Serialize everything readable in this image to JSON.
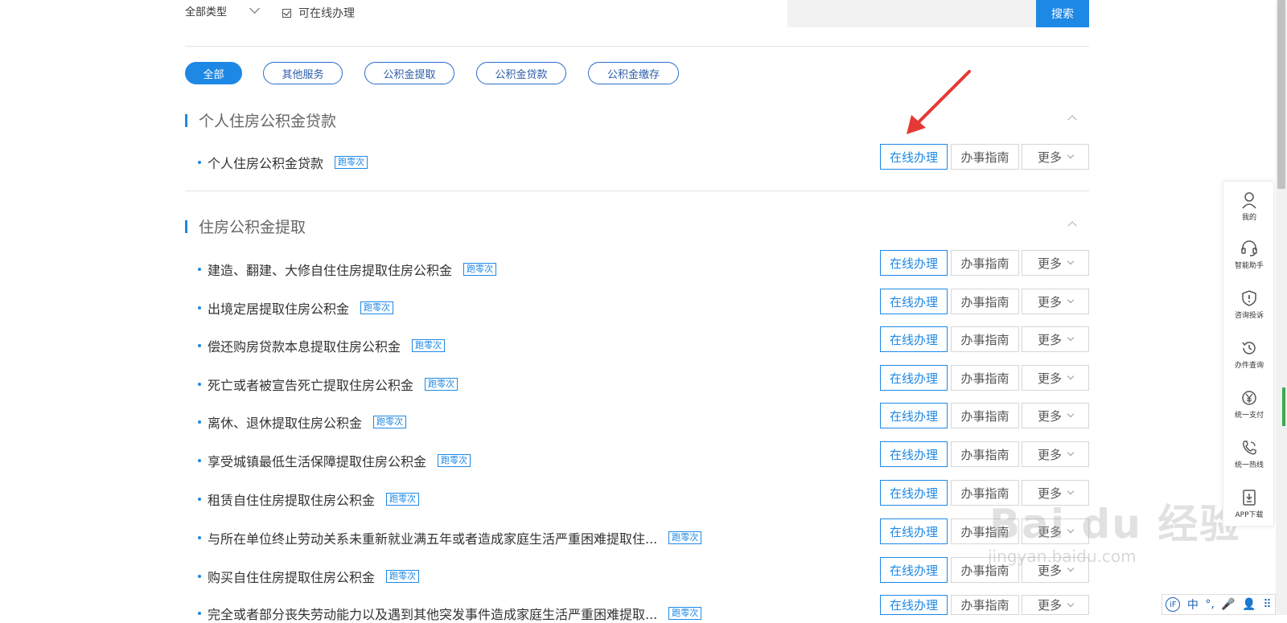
{
  "filter": {
    "type_label": "全部类型",
    "online_label": "可在线办理",
    "search_placeholder": "",
    "search_button": "搜索"
  },
  "tabs": [
    {
      "label": "全部",
      "active": true
    },
    {
      "label": "其他服务"
    },
    {
      "label": "公积金提取"
    },
    {
      "label": "公积金贷款"
    },
    {
      "label": "公积金缴存"
    }
  ],
  "actions": {
    "online": "在线办理",
    "guide": "办事指南",
    "more": "更多"
  },
  "tag_label": "跑零次",
  "sections": [
    {
      "title": "个人住房公积金贷款",
      "items": [
        "个人住房公积金贷款"
      ]
    },
    {
      "title": "住房公积金提取",
      "items": [
        "建造、翻建、大修自住住房提取住房公积金",
        "出境定居提取住房公积金",
        "偿还购房贷款本息提取住房公积金",
        "死亡或者被宣告死亡提取住房公积金",
        "离休、退休提取住房公积金",
        "享受城镇最低生活保障提取住房公积金",
        "租赁自住住房提取住房公积金",
        "与所在单位终止劳动关系未重新就业满五年或者造成家庭生活严重困难提取住...",
        "购买自住住房提取住房公积金",
        "完全或者部分丧失劳动能力以及遇到其他突发事件造成家庭生活严重困难提取..."
      ]
    }
  ],
  "sidebar": [
    {
      "label": "我的",
      "icon": "user-icon"
    },
    {
      "label": "智能助手",
      "icon": "headset-icon"
    },
    {
      "label": "咨询投诉",
      "icon": "shield-alert-icon"
    },
    {
      "label": "办件查询",
      "icon": "history-icon"
    },
    {
      "label": "统一支付",
      "icon": "yen-icon"
    },
    {
      "label": "统一热线",
      "icon": "phone-icon"
    },
    {
      "label": "APP下载",
      "icon": "download-icon"
    }
  ],
  "watermark": {
    "main": "Bai du 经验",
    "sub": "jingyan.baidu.com"
  },
  "ime": {
    "chinese": "中",
    "punct": "°,",
    "mic": "🎤",
    "user": "👤",
    "grid": "⠿"
  },
  "colors": {
    "accent": "#1e88e5",
    "arrow": "#e53935"
  }
}
